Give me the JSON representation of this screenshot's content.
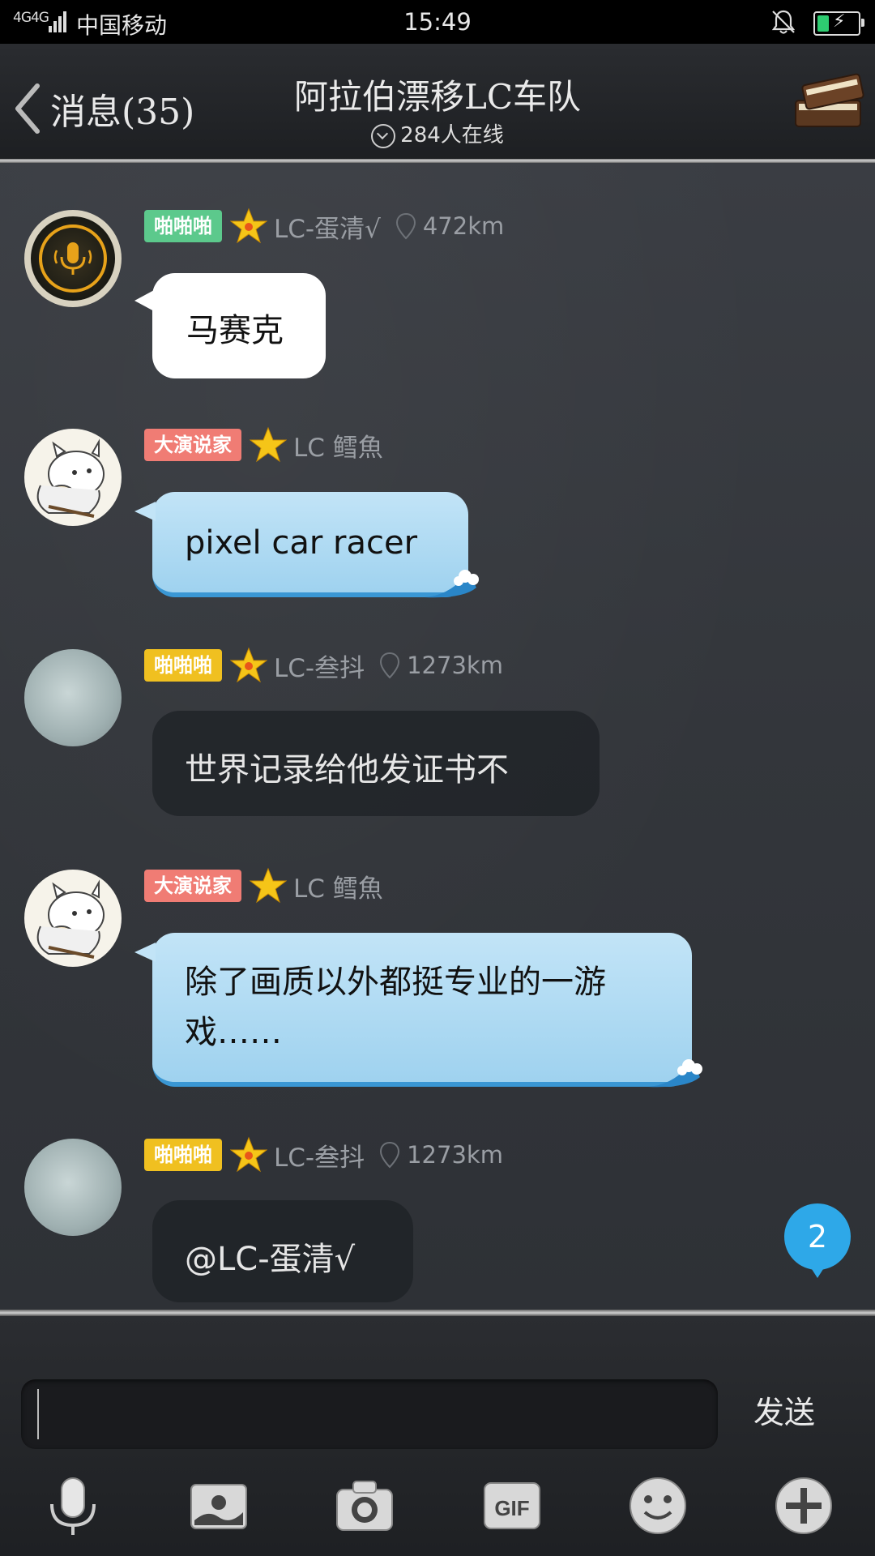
{
  "status_bar": {
    "network": "4G4G",
    "carrier": "中国移动",
    "time": "15:49"
  },
  "header": {
    "back_label": "消息(35)",
    "title": "阿拉伯漂移LC车队",
    "online": "284人在线"
  },
  "messages": [
    {
      "badge": "啪啪啪",
      "badge_color": "#5cc98c",
      "nick": "LC-蛋清√",
      "distance": "472km",
      "text": "马赛克",
      "style": "white"
    },
    {
      "badge": "大演说家",
      "badge_color": "#f07c74",
      "nick": "LC 鳕魚",
      "distance": "",
      "text": "pixel car racer",
      "style": "blue"
    },
    {
      "badge": "啪啪啪",
      "badge_color": "#f0c020",
      "nick": "LC-叁抖",
      "distance": "1273km",
      "text": "世界记录给他发证书不",
      "style": "dark"
    },
    {
      "badge": "大演说家",
      "badge_color": "#f07c74",
      "nick": "LC 鳕魚",
      "distance": "",
      "text": "除了画质以外都挺专业的一游戏……",
      "style": "blue"
    },
    {
      "badge": "啪啪啪",
      "badge_color": "#f0c020",
      "nick": "LC-叁抖",
      "distance": "1273km",
      "text": "@LC-蛋清√",
      "style": "dark"
    }
  ],
  "unread_count": "2",
  "input": {
    "value": "",
    "send_label": "发送"
  },
  "toolbar_icons": [
    "microphone-icon",
    "image-icon",
    "camera-icon",
    "gif-icon",
    "emoji-icon",
    "plus-icon"
  ]
}
